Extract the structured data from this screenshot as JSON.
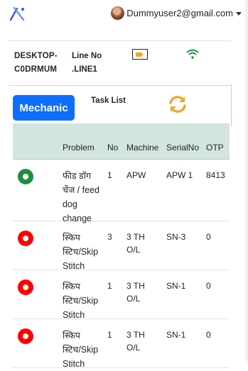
{
  "header": {
    "user_name": "Dummyuser2@gmail.com"
  },
  "info": {
    "desktop": "DESKTOP-C0DRMUM",
    "line_label": "Line No",
    "line_value": ".LINE1"
  },
  "actions": {
    "mechanic_label": "Mechanic",
    "tasklist_label": "Task List"
  },
  "colors": {
    "accent": "#0d6efd",
    "refresh": "#f5a623",
    "status_ok": "#1e8e3e",
    "status_alert": "#ff0000",
    "wifi": "#1e8e3e",
    "table_header": "#d2e5de"
  },
  "table": {
    "headers": [
      "Problem",
      "No",
      "Machine",
      "SerialNo",
      "OTP"
    ],
    "rows": [
      {
        "status": "green",
        "problem": [
          "फीड डॉग",
          "चेंज / feed",
          "dog",
          "change"
        ],
        "no": "1",
        "machine": [
          "APW"
        ],
        "serial": "APW 1",
        "otp": "8413"
      },
      {
        "status": "red",
        "problem": [
          "स्किप",
          "स्टिच/Skip",
          "Stitch"
        ],
        "no": "3",
        "machine": [
          "3 TH",
          "O/L"
        ],
        "serial": "SN-3",
        "otp": "0"
      },
      {
        "status": "red",
        "problem": [
          "स्किप",
          "स्टिच/Skip",
          "Stitch"
        ],
        "no": "1",
        "machine": [
          "3 TH",
          "O/L"
        ],
        "serial": "SN-1",
        "otp": "0"
      },
      {
        "status": "red",
        "problem": [
          "स्किप",
          "स्टिच/Skip",
          "Stitch"
        ],
        "no": "1",
        "machine": [
          "3 TH",
          "O/L"
        ],
        "serial": "SN-1",
        "otp": "0"
      }
    ]
  }
}
